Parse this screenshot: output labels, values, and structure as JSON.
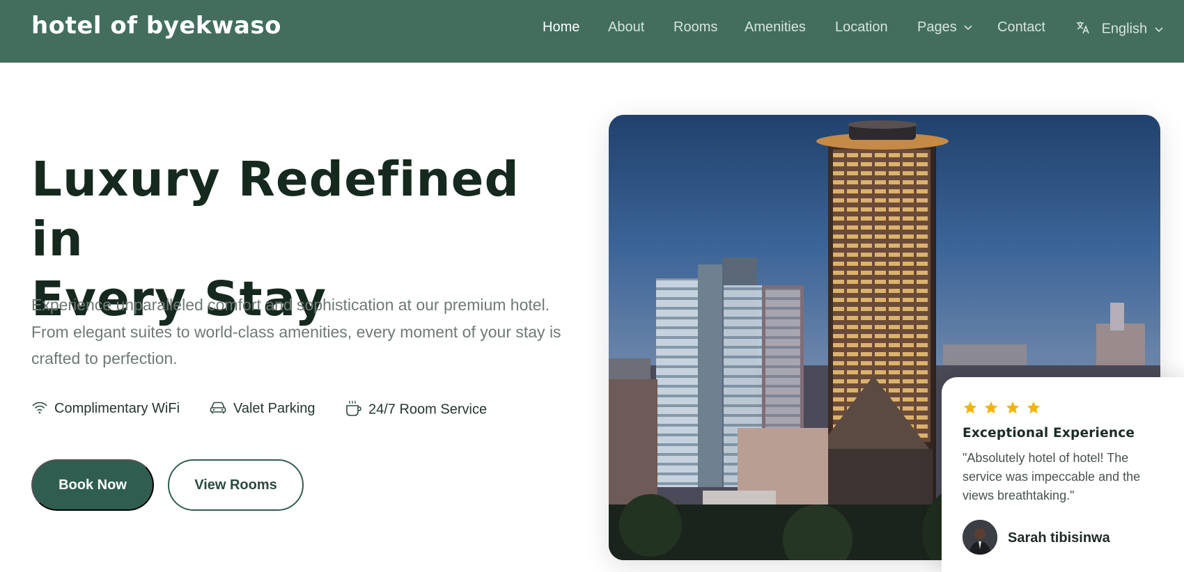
{
  "header": {
    "brand": "hotel of byekwaso",
    "nav": [
      {
        "label": "Home",
        "active": true
      },
      {
        "label": "About"
      },
      {
        "label": "Rooms"
      },
      {
        "label": "Amenities"
      },
      {
        "label": "Location"
      },
      {
        "label": "Pages",
        "has_dropdown": true
      },
      {
        "label": "Contact"
      }
    ],
    "language": {
      "label": "English",
      "icon": "translate-icon"
    }
  },
  "hero": {
    "title_line1": "Luxury Redefined in",
    "title_line2": "Every Stay",
    "description": "Experience unparalleled comfort and sophistication at our premium hotel. From elegant suites to world-class amenities, every moment of your stay is crafted to perfection.",
    "features": [
      {
        "label": "Complimentary WiFi",
        "icon": "wifi-icon"
      },
      {
        "label": "Valet Parking",
        "icon": "car-icon"
      },
      {
        "label": "24/7 Room Service",
        "icon": "coffee-cup-icon"
      }
    ],
    "buttons": {
      "primary": "Book Now",
      "secondary": "View Rooms"
    }
  },
  "review": {
    "rating": 4,
    "title": "Exceptional Experience",
    "quote": "\"Absolutely hotel of hotel! The service was impeccable and the views breathtaking.\"",
    "reviewer": "Sarah tibisinwa"
  },
  "colors": {
    "header_bg": "#436e5e",
    "primary": "#2f5e50",
    "star": "#f5b301",
    "heading": "#15291f"
  }
}
